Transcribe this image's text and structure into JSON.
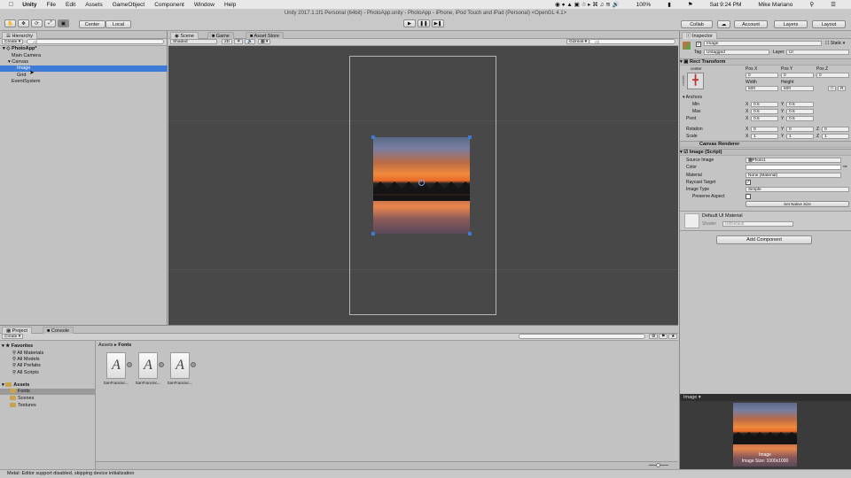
{
  "menubar": {
    "app": "Unity",
    "items": [
      "File",
      "Edit",
      "Assets",
      "GameObject",
      "Component",
      "Window",
      "Help"
    ],
    "battery": "100%",
    "clock": "Sat 9:24 PM",
    "user": "Mike Mariano"
  },
  "toolbar": {
    "window_title": "Unity 2017.1.1f1 Personal (64bit) - PhotoApp.unity - PhotoApp - iPhone, iPod Touch and iPad (Personal) <OpenGL 4.1>",
    "pivot": "Center",
    "space": "Local",
    "collab": "Collab",
    "account": "Account",
    "layers": "Layers",
    "layout": "Layout"
  },
  "hierarchy": {
    "tab": "Hierarchy",
    "create": "Create",
    "search_placeholder": "All",
    "items": [
      {
        "label": "PhotoApp*"
      },
      {
        "label": "Main Camera"
      },
      {
        "label": "Canvas"
      },
      {
        "label": "Image"
      },
      {
        "label": "Grid"
      },
      {
        "label": "EventSystem"
      }
    ]
  },
  "scene": {
    "tabs": [
      "Scene",
      "Game",
      "Asset Store"
    ],
    "shading": "Shaded",
    "mode": "2D",
    "gizmos": "Gizmos",
    "search_placeholder": "All"
  },
  "inspector": {
    "tab": "Inspector",
    "object_name": "Image",
    "static": "Static",
    "tag_label": "Tag",
    "tag": "Untagged",
    "layer_label": "Layer",
    "layer": "UI",
    "rect_transform": {
      "title": "Rect Transform",
      "anchor_preset": "center",
      "side_label": "middle",
      "pos_labels": [
        "Pos X",
        "Pos Y",
        "Pos Z"
      ],
      "pos": [
        "0",
        "0",
        "0"
      ],
      "width_label": "Width",
      "height_label": "Height",
      "width": "500",
      "height": "500",
      "anchors": "Anchors",
      "min": "Min",
      "max": "Max",
      "pivot": "Pivot",
      "x_label": "X",
      "y_label": "Y",
      "z_label": "Z",
      "anchor_min": [
        "0.5",
        "0.5"
      ],
      "anchor_max": [
        "0.5",
        "0.5"
      ],
      "pivot_values": [
        "0.5",
        "0.5"
      ],
      "rotation_label": "Rotation",
      "rotation": [
        "0",
        "0",
        "0"
      ],
      "scale_label": "Scale",
      "scale": [
        "1",
        "1",
        "1"
      ]
    },
    "canvas_renderer": "Canvas Renderer",
    "image_script": {
      "title": "Image (Script)",
      "source_image_label": "Source Image",
      "source_image": "Photo1",
      "color_label": "Color",
      "material_label": "Material",
      "material": "None (Material)",
      "raycast_label": "Raycast Target",
      "image_type_label": "Image Type",
      "image_type": "Simple",
      "preserve_label": "Preserve Aspect",
      "native_size": "Set Native Size"
    },
    "material_block": {
      "name": "Default UI Material",
      "shader_label": "Shader",
      "shader": "UI/Default"
    },
    "add_component": "Add Component"
  },
  "project": {
    "tabs": [
      "Project",
      "Console"
    ],
    "create": "Create",
    "favorites": "Favorites",
    "favorite_items": [
      "All Materials",
      "All Models",
      "All Prefabs",
      "All Scripts"
    ],
    "assets": "Assets",
    "asset_folders": [
      "Fonts",
      "Scenes",
      "Textures"
    ],
    "breadcrumb": [
      "Assets",
      "Fonts"
    ],
    "files": [
      "SanFrancisc...",
      "SanFrancisc...",
      "SanFrancisc..."
    ]
  },
  "preview": {
    "title": "Image",
    "caption_name": "Image",
    "caption_size": "Image Size: 1000x1000"
  },
  "status": "Metal: Editor support disabled, skipping device initialization"
}
